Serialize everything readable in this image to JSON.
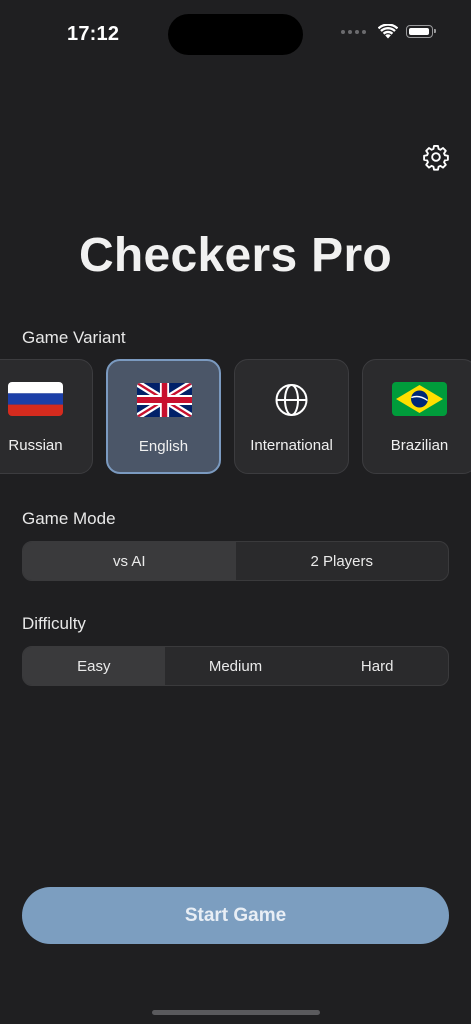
{
  "status_bar": {
    "time": "17:12"
  },
  "app": {
    "title": "Checkers Pro"
  },
  "icons": {
    "settings": "gear-icon",
    "international": "globe-icon",
    "wifi": "wifi-icon",
    "battery": "battery-icon"
  },
  "variant_section": {
    "label": "Game Variant",
    "items": [
      {
        "label": "Russian",
        "selected": false
      },
      {
        "label": "English",
        "selected": true
      },
      {
        "label": "International",
        "selected": false
      },
      {
        "label": "Brazilian",
        "selected": false
      }
    ]
  },
  "mode_section": {
    "label": "Game Mode",
    "options": [
      "vs AI",
      "2 Players"
    ],
    "selected": "vs AI"
  },
  "difficulty_section": {
    "label": "Difficulty",
    "options": [
      "Easy",
      "Medium",
      "Hard"
    ],
    "selected": "Easy"
  },
  "start_button": {
    "label": "Start Game"
  },
  "colors": {
    "background": "#1f1f21",
    "card": "#2b2b2d",
    "selected_card": "#4b5668",
    "selected_border": "#7b9ac0",
    "accent": "#7c9ec0"
  }
}
